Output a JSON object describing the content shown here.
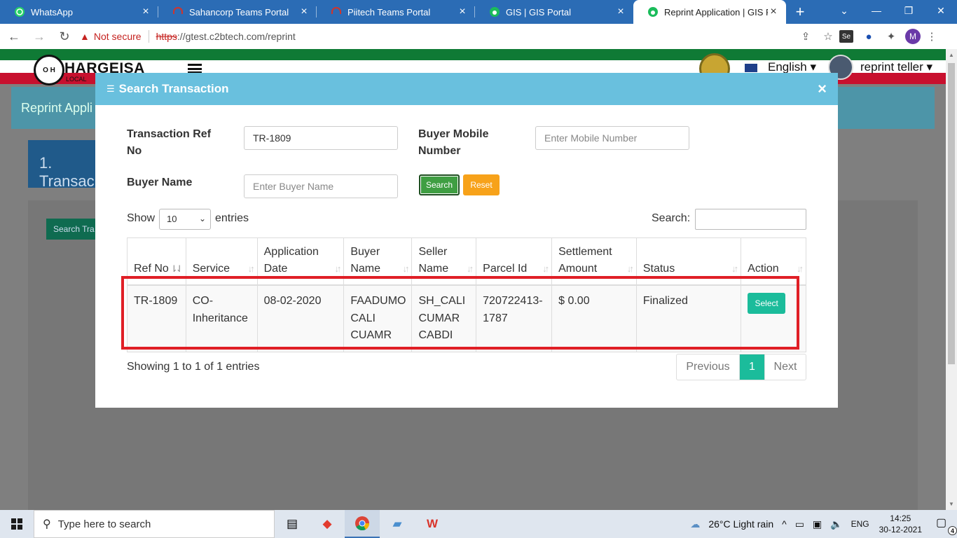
{
  "browser": {
    "tabs": [
      {
        "title": "WhatsApp",
        "icon": "whatsapp-icon",
        "color": "#25d366"
      },
      {
        "title": "Sahancorp Teams Portal",
        "icon": "headset-icon",
        "color": "#d0342c"
      },
      {
        "title": "Piitech Teams Portal",
        "icon": "headset-icon",
        "color": "#d0342c"
      },
      {
        "title": "GIS | GIS Portal",
        "icon": "gis-icon",
        "color": "#1bbc5b"
      },
      {
        "title": "Reprint Application | GIS Portal",
        "icon": "gis-icon",
        "color": "#1bbc5b"
      }
    ],
    "new_tab": "+",
    "security_text": "Not secure",
    "url_scheme": "https",
    "url_rest": "://gtest.c2btech.com/reprint",
    "profile_initial": "M",
    "ext_label": "Se"
  },
  "site": {
    "logo_initials": "O H",
    "logo_text": "HARGEISA",
    "logo_sub": "LOCAL",
    "language": "English ▾",
    "user": "reprint teller ▾",
    "bg_title": "Reprint Appli",
    "bg_step": "1. Transac",
    "bg_button": "Search Tra"
  },
  "modal": {
    "title": "Search Transaction",
    "close": "×",
    "labels": {
      "ref": "Transaction Ref No",
      "mobile": "Buyer Mobile Number",
      "buyer": "Buyer Name"
    },
    "inputs": {
      "ref_value": "TR-1809",
      "mobile_placeholder": "Enter Mobile Number",
      "buyer_placeholder": "Enter Buyer Name"
    },
    "search_button": "Search",
    "reset_button": "Reset",
    "show_label": "Show",
    "entries_label": "entries",
    "length_value": "10",
    "search_label": "Search:",
    "columns": [
      "Ref No",
      "Service",
      "Application Date",
      "Buyer Name",
      "Seller Name",
      "Parcel Id",
      "Settlement Amount",
      "Status",
      "Action"
    ],
    "rows": [
      {
        "ref": "TR-1809",
        "service": "CO-Inheritance",
        "date": "08-02-2020",
        "buyer": "FAADUMO CALI CUAMR",
        "seller": "SH_CALI CUMAR CABDI",
        "parcel": "720722413-1787",
        "amount": "$ 0.00",
        "status": "Finalized",
        "action": "Select"
      }
    ],
    "info": "Showing 1 to 1 of 1 entries",
    "pagination": {
      "previous": "Previous",
      "current": "1",
      "next": "Next"
    }
  },
  "taskbar": {
    "search_placeholder": "Type here to search",
    "weather": "26°C  Light rain",
    "language": "ENG",
    "time": "14:25",
    "date": "30-12-2021",
    "notifications": "4"
  },
  "colors": {
    "modal_header": "#69c0de",
    "accent_teal": "#1bbc9b",
    "search_green": "#3f9e42",
    "reset_orange": "#f7a21a",
    "highlight_red": "#e01f26"
  }
}
